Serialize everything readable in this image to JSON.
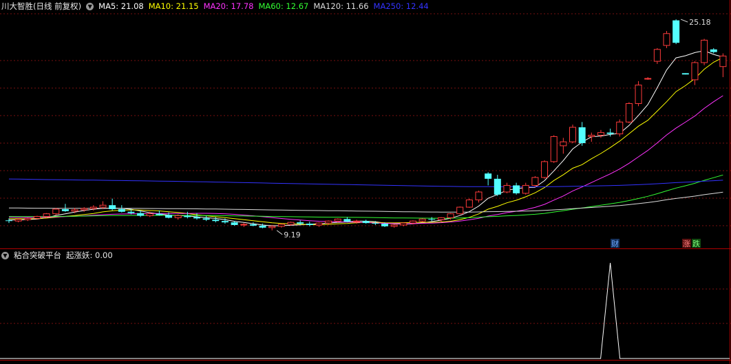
{
  "main_header": {
    "title": "川大智胜(日线 前复权)",
    "ma": [
      {
        "label": "MA5: 21.08",
        "color": "#ffffff"
      },
      {
        "label": "MA10: 21.15",
        "color": "#ffff00"
      },
      {
        "label": "MA20: 17.78",
        "color": "#ff33ff"
      },
      {
        "label": "MA60: 12.67",
        "color": "#33ff33"
      },
      {
        "label": "MA120: 11.66",
        "color": "#dddddd"
      },
      {
        "label": "MA250: 12.44",
        "color": "#3333ff"
      }
    ]
  },
  "annotations": {
    "high_label": "25.18",
    "low_label": "9.19",
    "badge_cai": "财",
    "badge_zhang": "涨",
    "badge_die": "跌"
  },
  "sub_header": {
    "title": "粘合突破平台",
    "indicator": "起涨妖: 0.00"
  },
  "colors": {
    "up": "#ff3b3b",
    "down": "#54ffff",
    "grid": "#7a1010",
    "border": "#b00000"
  },
  "chart_data": {
    "type": "candlestick",
    "ohlc": [
      [
        9.95,
        10.1,
        9.75,
        9.92
      ],
      [
        9.9,
        10.12,
        9.8,
        10.02
      ],
      [
        10.0,
        10.15,
        9.9,
        10.1
      ],
      [
        10.1,
        10.3,
        10.0,
        10.25
      ],
      [
        10.25,
        10.5,
        10.15,
        10.45
      ],
      [
        10.45,
        10.9,
        10.35,
        10.8
      ],
      [
        10.8,
        11.2,
        10.6,
        10.65
      ],
      [
        10.65,
        10.9,
        10.5,
        10.75
      ],
      [
        10.75,
        10.95,
        10.6,
        10.85
      ],
      [
        10.85,
        11.1,
        10.7,
        10.95
      ],
      [
        10.95,
        11.4,
        10.8,
        11.1
      ],
      [
        11.1,
        11.6,
        10.7,
        10.8
      ],
      [
        10.8,
        11.1,
        10.55,
        10.6
      ],
      [
        10.6,
        10.8,
        10.4,
        10.5
      ],
      [
        10.5,
        10.7,
        10.2,
        10.3
      ],
      [
        10.3,
        10.6,
        10.2,
        10.45
      ],
      [
        10.45,
        10.7,
        10.3,
        10.35
      ],
      [
        10.35,
        10.55,
        10.1,
        10.15
      ],
      [
        10.15,
        10.4,
        10.0,
        10.3
      ],
      [
        10.3,
        10.6,
        10.1,
        10.2
      ],
      [
        10.2,
        10.5,
        10.0,
        10.1
      ],
      [
        10.1,
        10.3,
        9.9,
        10.0
      ],
      [
        10.0,
        10.2,
        9.8,
        9.9
      ],
      [
        9.9,
        10.1,
        9.7,
        9.8
      ],
      [
        9.8,
        9.9,
        9.55,
        9.6
      ],
      [
        9.6,
        9.75,
        9.45,
        9.65
      ],
      [
        9.65,
        9.8,
        9.5,
        9.55
      ],
      [
        9.55,
        9.7,
        9.35,
        9.4
      ],
      [
        9.4,
        9.6,
        9.19,
        9.5
      ],
      [
        9.5,
        9.7,
        9.4,
        9.65
      ],
      [
        9.65,
        9.85,
        9.55,
        9.8
      ],
      [
        9.8,
        9.95,
        9.6,
        9.7
      ],
      [
        9.7,
        9.85,
        9.5,
        9.6
      ],
      [
        9.6,
        9.8,
        9.45,
        9.75
      ],
      [
        9.75,
        9.95,
        9.6,
        9.9
      ],
      [
        9.9,
        10.1,
        9.8,
        10.05
      ],
      [
        10.05,
        10.2,
        9.8,
        9.85
      ],
      [
        9.85,
        10.0,
        9.7,
        9.9
      ],
      [
        9.9,
        10.0,
        9.7,
        9.75
      ],
      [
        9.75,
        9.9,
        9.6,
        9.7
      ],
      [
        9.7,
        9.8,
        9.45,
        9.5
      ],
      [
        9.5,
        9.65,
        9.4,
        9.6
      ],
      [
        9.6,
        9.8,
        9.5,
        9.75
      ],
      [
        9.75,
        9.95,
        9.65,
        9.9
      ],
      [
        9.9,
        10.1,
        9.8,
        10.05
      ],
      [
        10.05,
        10.2,
        9.9,
        10.0
      ],
      [
        10.0,
        10.2,
        9.85,
        10.15
      ],
      [
        10.15,
        10.5,
        10.0,
        10.45
      ],
      [
        10.45,
        11.0,
        10.4,
        10.95
      ],
      [
        10.95,
        11.6,
        10.9,
        11.5
      ],
      [
        11.5,
        12.2,
        11.3,
        12.1
      ],
      [
        13.5,
        13.6,
        12.6,
        13.1
      ],
      [
        13.1,
        13.4,
        11.8,
        11.9
      ],
      [
        12.1,
        12.8,
        12.0,
        12.6
      ],
      [
        12.6,
        12.8,
        11.9,
        12.0
      ],
      [
        12.0,
        12.8,
        11.9,
        12.6
      ],
      [
        12.6,
        13.3,
        12.5,
        13.2
      ],
      [
        13.2,
        14.5,
        13.1,
        14.4
      ],
      [
        14.4,
        16.4,
        14.3,
        16.3
      ],
      [
        15.6,
        16.2,
        15.0,
        15.9
      ],
      [
        15.9,
        17.2,
        15.8,
        17.0
      ],
      [
        17.0,
        17.4,
        15.6,
        15.8
      ],
      [
        16.3,
        16.6,
        15.9,
        16.4
      ],
      [
        16.4,
        16.8,
        16.2,
        16.6
      ],
      [
        16.6,
        16.9,
        16.3,
        16.5
      ],
      [
        16.5,
        17.6,
        16.3,
        17.4
      ],
      [
        17.4,
        18.9,
        17.3,
        18.8
      ],
      [
        18.8,
        20.5,
        18.6,
        20.2
      ],
      [
        20.7,
        20.8,
        20.6,
        20.7
      ],
      [
        22.0,
        23.0,
        21.8,
        22.9
      ],
      [
        23.2,
        24.3,
        23.0,
        24.1
      ],
      [
        25.1,
        25.18,
        23.3,
        23.4
      ],
      [
        21.1,
        21.1,
        21.0,
        21.0
      ],
      [
        20.6,
        22.0,
        20.2,
        21.9
      ],
      [
        21.9,
        23.7,
        21.7,
        23.6
      ],
      [
        22.9,
        23.0,
        22.6,
        22.7
      ],
      [
        21.6,
        22.6,
        20.8,
        22.4
      ]
    ],
    "ma_series": [
      "MA5",
      "MA10",
      "MA20",
      "MA60",
      "MA120",
      "MA250"
    ],
    "y_high": 25.18,
    "y_low": 9.19,
    "indicator": {
      "name": "起涨妖",
      "spike_bar": 64,
      "value": 0.0
    }
  }
}
